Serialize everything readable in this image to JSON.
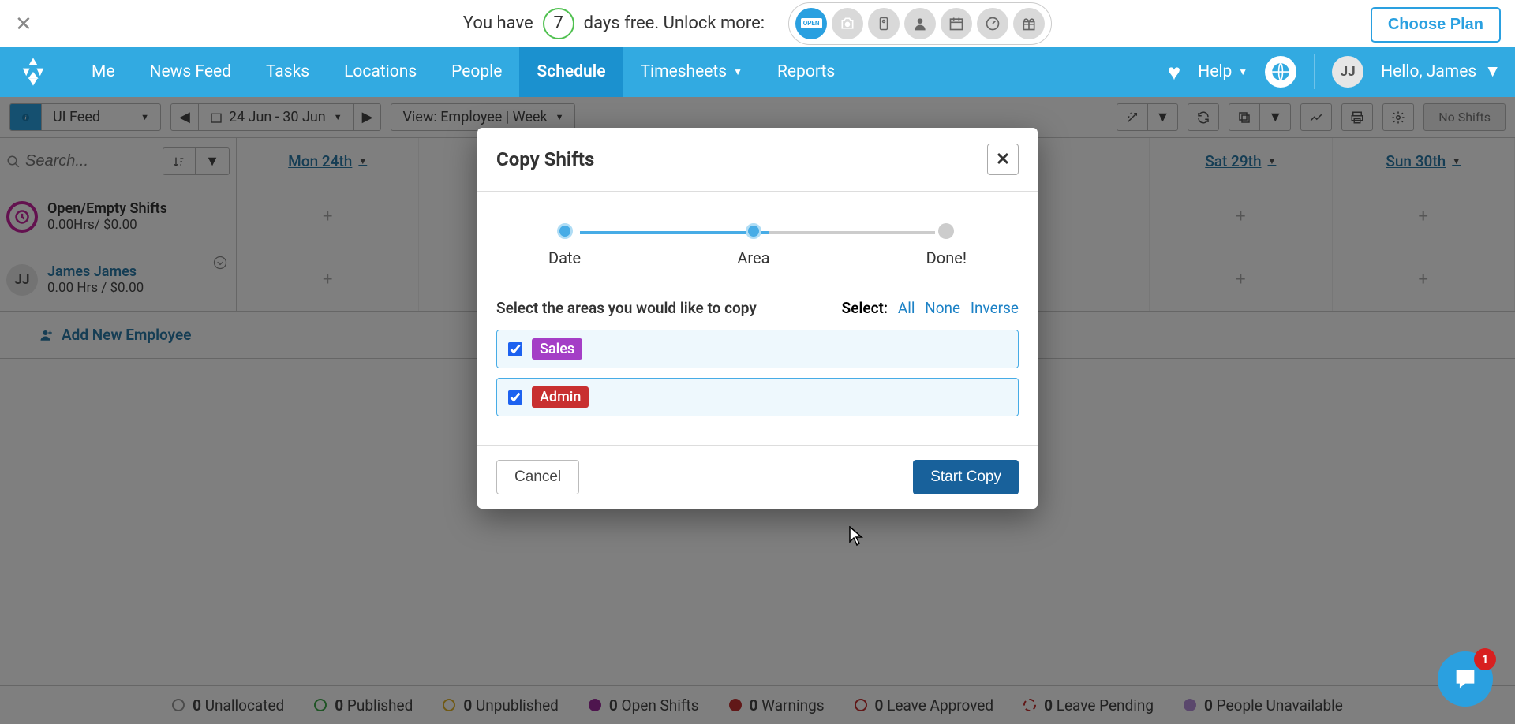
{
  "banner": {
    "prefix": "You have",
    "days": "7",
    "suffix": "days free. Unlock more:",
    "open_label": "OPEN",
    "choose_plan": "Choose Plan"
  },
  "nav": {
    "items": [
      "Me",
      "News Feed",
      "Tasks",
      "Locations",
      "People",
      "Schedule",
      "Timesheets",
      "Reports"
    ],
    "active": "Schedule",
    "help": "Help",
    "avatar_initials": "JJ",
    "hello": "Hello, James"
  },
  "toolbar": {
    "ui_feed": "UI Feed",
    "date_range": "24 Jun - 30 Jun",
    "view_label": "View:  Employee | Week",
    "no_shifts": "No Shifts"
  },
  "search": {
    "placeholder": "Search..."
  },
  "days": [
    "Mon 24th",
    "",
    "",
    "",
    "",
    "Sat 29th",
    "Sun 30th"
  ],
  "rows": {
    "open": {
      "title": "Open/Empty Shifts",
      "sub": "0.00Hrs/ $0.00"
    },
    "emp": {
      "initials": "JJ",
      "name": "James James",
      "sub": "0.00 Hrs / $0.00"
    }
  },
  "add_employee": "Add New Employee",
  "legend": [
    {
      "count": "0",
      "label": "Unallocated",
      "color": "#999",
      "filled": false
    },
    {
      "count": "0",
      "label": "Published",
      "color": "#3fa84b",
      "filled": false
    },
    {
      "count": "0",
      "label": "Unpublished",
      "color": "#e0b32b",
      "filled": false
    },
    {
      "count": "0",
      "label": "Open Shifts",
      "color": "#9c2a9c",
      "filled": true
    },
    {
      "count": "0",
      "label": "Warnings",
      "color": "#c23030",
      "filled": true
    },
    {
      "count": "0",
      "label": "Leave Approved",
      "color": "#c23030",
      "filled": false
    },
    {
      "count": "0",
      "label": "Leave Pending",
      "color": "#c23030",
      "filled": false
    },
    {
      "count": "0",
      "label": "People Unavailable",
      "color": "#b58fd9",
      "filled": true
    }
  ],
  "modal": {
    "title": "Copy Shifts",
    "steps": [
      "Date",
      "Area",
      "Done!"
    ],
    "prompt": "Select the areas you would like to copy",
    "select_label": "Select:",
    "select_all": "All",
    "select_none": "None",
    "select_inverse": "Inverse",
    "areas": [
      {
        "name": "Sales",
        "color": "#a43ec6",
        "checked": true
      },
      {
        "name": "Admin",
        "color": "#c83030",
        "checked": true
      }
    ],
    "cancel": "Cancel",
    "confirm": "Start Copy"
  },
  "chat": {
    "badge": "1"
  }
}
